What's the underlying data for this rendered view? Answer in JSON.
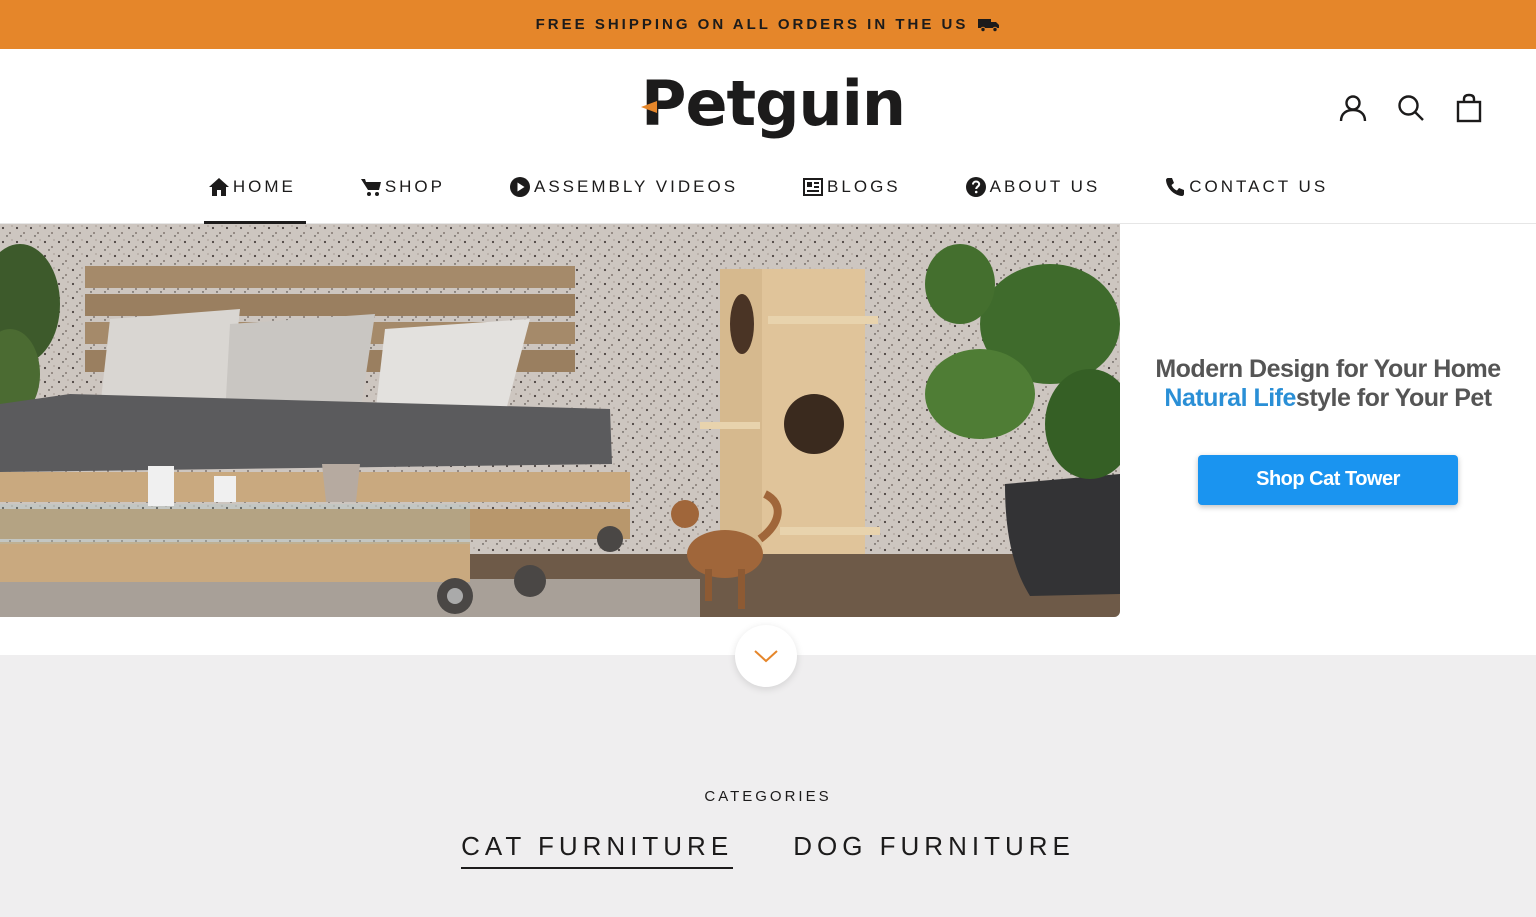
{
  "announcement": {
    "text": "FREE SHIPPING ON ALL ORDERS IN THE US",
    "icon": "truck-icon"
  },
  "brand": {
    "logo_text": "Petguin",
    "accent": "#e5862a"
  },
  "header_icons": [
    "account-icon",
    "search-icon",
    "cart-icon"
  ],
  "nav": [
    {
      "label": "HOME",
      "icon": "home-icon",
      "active": true
    },
    {
      "label": "SHOP",
      "icon": "cart-icon"
    },
    {
      "label": "ASSEMBLY VIDEOS",
      "icon": "play-icon"
    },
    {
      "label": "BLOGS",
      "icon": "newspaper-icon"
    },
    {
      "label": "ABOUT US",
      "icon": "question-icon"
    },
    {
      "label": "CONTACT US",
      "icon": "phone-icon"
    }
  ],
  "hero": {
    "line1": "Modern Design for Your Home",
    "line2_blue": "Natural Life",
    "line2_rest": "style for Your Pet",
    "button": "Shop Cat Tower",
    "button_color": "#1a94f0"
  },
  "categories": {
    "heading": "CATEGORIES",
    "tabs": [
      {
        "label": "CAT FURNITURE",
        "active": true
      },
      {
        "label": "DOG FURNITURE"
      }
    ]
  }
}
